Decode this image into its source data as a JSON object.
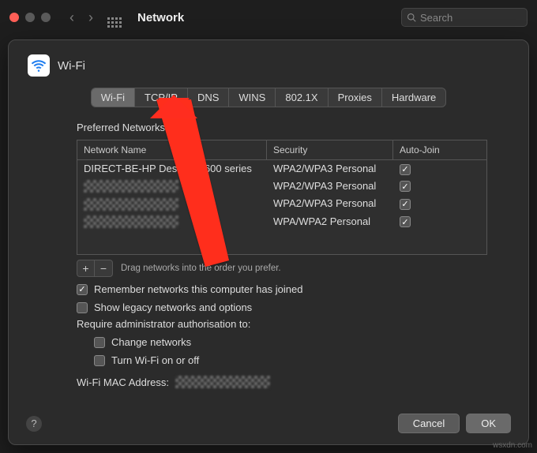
{
  "window": {
    "title": "Network",
    "search_placeholder": "Search"
  },
  "sheet": {
    "title": "Wi-Fi",
    "tabs": [
      "Wi-Fi",
      "TCP/IP",
      "DNS",
      "WINS",
      "802.1X",
      "Proxies",
      "Hardware"
    ],
    "active_tab": 0,
    "preferred_label": "Preferred Networks:",
    "columns": {
      "name": "Network Name",
      "security": "Security",
      "autojoin": "Auto-Join"
    },
    "rows": [
      {
        "name": "DIRECT-BE-HP DeskJet 2600 series",
        "security": "WPA2/WPA3 Personal",
        "autojoin": true,
        "redacted": false
      },
      {
        "name": "",
        "security": "WPA2/WPA3 Personal",
        "autojoin": true,
        "redacted": true
      },
      {
        "name": "",
        "security": "WPA2/WPA3 Personal",
        "autojoin": true,
        "redacted": true
      },
      {
        "name": "",
        "security": "WPA/WPA2 Personal",
        "autojoin": true,
        "redacted": true
      }
    ],
    "drag_hint": "Drag networks into the order you prefer.",
    "remember": {
      "label": "Remember networks this computer has joined",
      "checked": true
    },
    "legacy": {
      "label": "Show legacy networks and options",
      "checked": false
    },
    "require_label": "Require administrator authorisation to:",
    "change_net": {
      "label": "Change networks",
      "checked": false
    },
    "toggle_wifi": {
      "label": "Turn Wi-Fi on or off",
      "checked": false
    },
    "mac_label": "Wi-Fi MAC Address:",
    "buttons": {
      "cancel": "Cancel",
      "ok": "OK",
      "add": "+",
      "remove": "−"
    }
  },
  "watermark": "wsxdn.com"
}
